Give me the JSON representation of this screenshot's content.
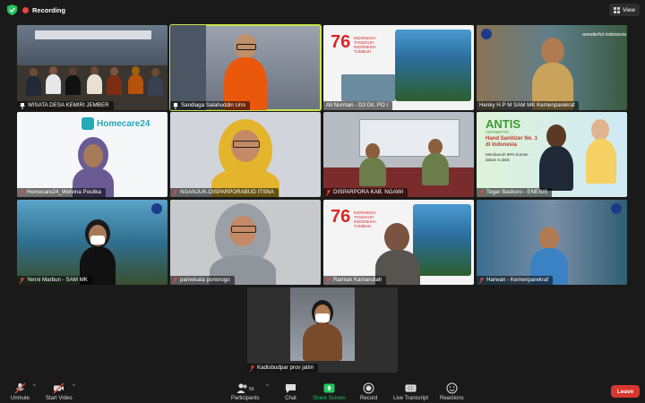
{
  "status": {
    "recording_label": "Recording"
  },
  "view_button": {
    "label": "View"
  },
  "participants": [
    {
      "id": "p1",
      "name": "WISATA DESA KEMIRI JEMBER",
      "muted": false,
      "pinned": true
    },
    {
      "id": "p2",
      "name": "Sandiaga Salahuddin Uno",
      "muted": false,
      "pinned": true,
      "active_speaker": true
    },
    {
      "id": "p3",
      "name": "Ali Nurman - D3 Dit. PO I",
      "muted": false,
      "pinned": false
    },
    {
      "id": "p4",
      "name": "Henky H.P M SAM MK Kemenparekraf",
      "muted": false,
      "pinned": false
    },
    {
      "id": "p5",
      "name": "Homecare24_Welvina Poulika",
      "muted": true,
      "pinned": false
    },
    {
      "id": "p6",
      "name": "NGANJUK-DISPARPORABUD ITSNA",
      "muted": true,
      "pinned": false
    },
    {
      "id": "p7",
      "name": "DISPARPORA KAB. NGAWI",
      "muted": true,
      "pinned": false
    },
    {
      "id": "p8",
      "name": "Tegar Baskoro - ENESIS",
      "muted": true,
      "pinned": false
    },
    {
      "id": "p9",
      "name": "Yenni Marbun - SAM MK",
      "muted": true,
      "pinned": false
    },
    {
      "id": "p10",
      "name": "pariwisata ponorogo",
      "muted": true,
      "pinned": false
    },
    {
      "id": "p11",
      "name": "Ramlan Kamarullah",
      "muted": true,
      "pinned": false
    },
    {
      "id": "p12",
      "name": "Harwan - Kemenparekraf",
      "muted": true,
      "pinned": false
    },
    {
      "id": "p13",
      "name": "Kadisbudpar prov jatim",
      "muted": true,
      "pinned": false
    }
  ],
  "tile_text": {
    "homecare_logo": "Homecare24",
    "antis_brand": "ANTIS",
    "antis_sub": "ANTISEPTIC",
    "antis_headline": "Hand Sanitizer No. 1 di Indonesia",
    "antis_claim": "Membunuh 99% kuman dalam 6 detik",
    "ri76_number": "76",
    "ri76_caption": "INDONESIA TANGGUH INDONESIA TUMBUH",
    "wonderful_indonesia": "wonderful indonesia"
  },
  "toolbar": {
    "unmute": "Unmute",
    "start_video": "Start Video",
    "participants": "Participants",
    "participant_count": "50",
    "chat": "Chat",
    "share_screen": "Share Screen",
    "record": "Record",
    "live_transcript": "Live Transcript",
    "reactions": "Reactions",
    "leave": "Leave"
  },
  "colors": {
    "accent_active_border": "#c9e14a",
    "leave_red": "#d8372f",
    "share_green": "#22c55e",
    "recording_red": "#e5483b"
  }
}
